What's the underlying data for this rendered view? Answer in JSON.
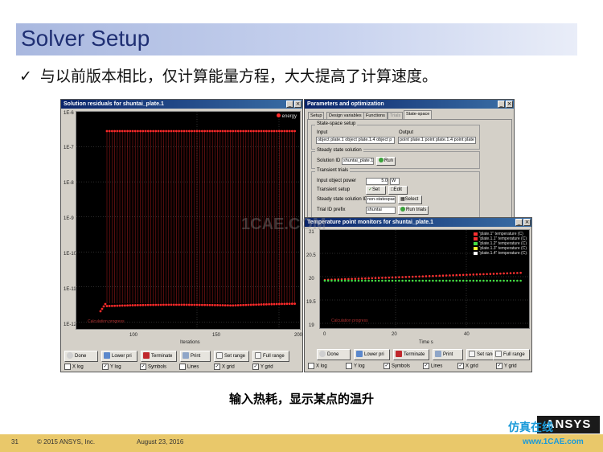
{
  "slide": {
    "title": "Solver Setup",
    "bullet": "与以前版本相比，仅计算能量方程，大大提高了计算速度。",
    "caption": "输入热耗，显示某点的温升",
    "page_number": "31",
    "copyright": "© 2015 ANSYS, Inc.",
    "date": "August 23, 2016",
    "logo_text": "ANSYS",
    "brand_text": "仿真在线",
    "site_text": "www.1CAE.com",
    "watermark": "1CAE.COM"
  },
  "residuals_window": {
    "title": "Solution residuals for shuntai_plate.1",
    "legend_label": "energy",
    "y_ticks": [
      "1E-6",
      "1E-7",
      "1E-8",
      "1E-9",
      "1E-10",
      "1E-11",
      "1E-12"
    ],
    "x_ticks": [
      "100",
      "150",
      "200"
    ],
    "x_label": "Iterations",
    "plot_note": "Calculation progress",
    "buttons": [
      "Done",
      "Lower pri",
      "Terminate",
      "Print",
      "Set range",
      "Full range"
    ],
    "checkboxes": [
      {
        "label": "X log",
        "checked": false
      },
      {
        "label": "Y log",
        "checked": true
      },
      {
        "label": "Symbols",
        "checked": true
      },
      {
        "label": "Lines",
        "checked": false
      },
      {
        "label": "X grid",
        "checked": true
      },
      {
        "label": "Y grid",
        "checked": true
      }
    ]
  },
  "params_window": {
    "title": "Parameters and optimization",
    "tabs": [
      "Setup",
      "Design variables",
      "Functions",
      "Trials",
      "State-space"
    ],
    "active_tab": "State-space",
    "state_space_setup": {
      "group_label": "State-space setup",
      "input_label": "Input",
      "output_label": "Output",
      "input_value": "object plate.1 object plate.1.4 object p",
      "output_value": "point plate.1 point plate.1.4 point plate"
    },
    "steady_state": {
      "group_label": "Steady state solution",
      "solution_id_label": "Solution ID",
      "solution_id_value": "shuntai_plate.1",
      "run_label": "Run"
    },
    "transient": {
      "group_label": "Transient trials",
      "input_power_label": "Input object power",
      "input_power_value": "5.0",
      "input_power_unit": "W",
      "setup_label": "Transient setup",
      "set_label": "Set",
      "edit_label": "Edit",
      "steady_id_label": "Steady state solution ID",
      "steady_id_value": "non-statespace",
      "select_label": "Select",
      "prefix_label": "Trial ID prefix",
      "prefix_value": "shuntai",
      "run_trials_label": "Run trials"
    }
  },
  "temperature_window": {
    "title": "Temperature point monitors for shuntai_plate.1",
    "legend": [
      {
        "label": "\"plate.1\" temperature (C)",
        "color": "#ff3030"
      },
      {
        "label": "\"plate.1.1\" temperature (C)",
        "color": "#ff3030"
      },
      {
        "label": "\"plate.1.2\" temperature (C)",
        "color": "#44dd44"
      },
      {
        "label": "\"plate.1.3\" temperature (C)",
        "color": "#ffff33"
      },
      {
        "label": "\"plate.1.4\" temperature (C)",
        "color": "#ffffff"
      }
    ],
    "y_ticks": [
      "21",
      "20.5",
      "20",
      "19.5",
      "19"
    ],
    "x_ticks": [
      "0",
      "20",
      "40"
    ],
    "x_label": "Time s",
    "plot_note": "Calculation progress",
    "buttons": [
      "Done",
      "Lower pri",
      "Terminate",
      "Print",
      "Set range",
      "Full range"
    ],
    "checkboxes": [
      {
        "label": "X log",
        "checked": false
      },
      {
        "label": "Y log",
        "checked": false
      },
      {
        "label": "Symbols",
        "checked": true
      },
      {
        "label": "Lines",
        "checked": true
      },
      {
        "label": "X grid",
        "checked": true
      },
      {
        "label": "Y grid",
        "checked": true
      }
    ]
  },
  "colors": {
    "residual_series": "#ff2a2a",
    "plate_red": "#ff3030",
    "plate_green": "#44dd44",
    "title_bar": "#0a246a",
    "footer": "#e9c86a"
  }
}
